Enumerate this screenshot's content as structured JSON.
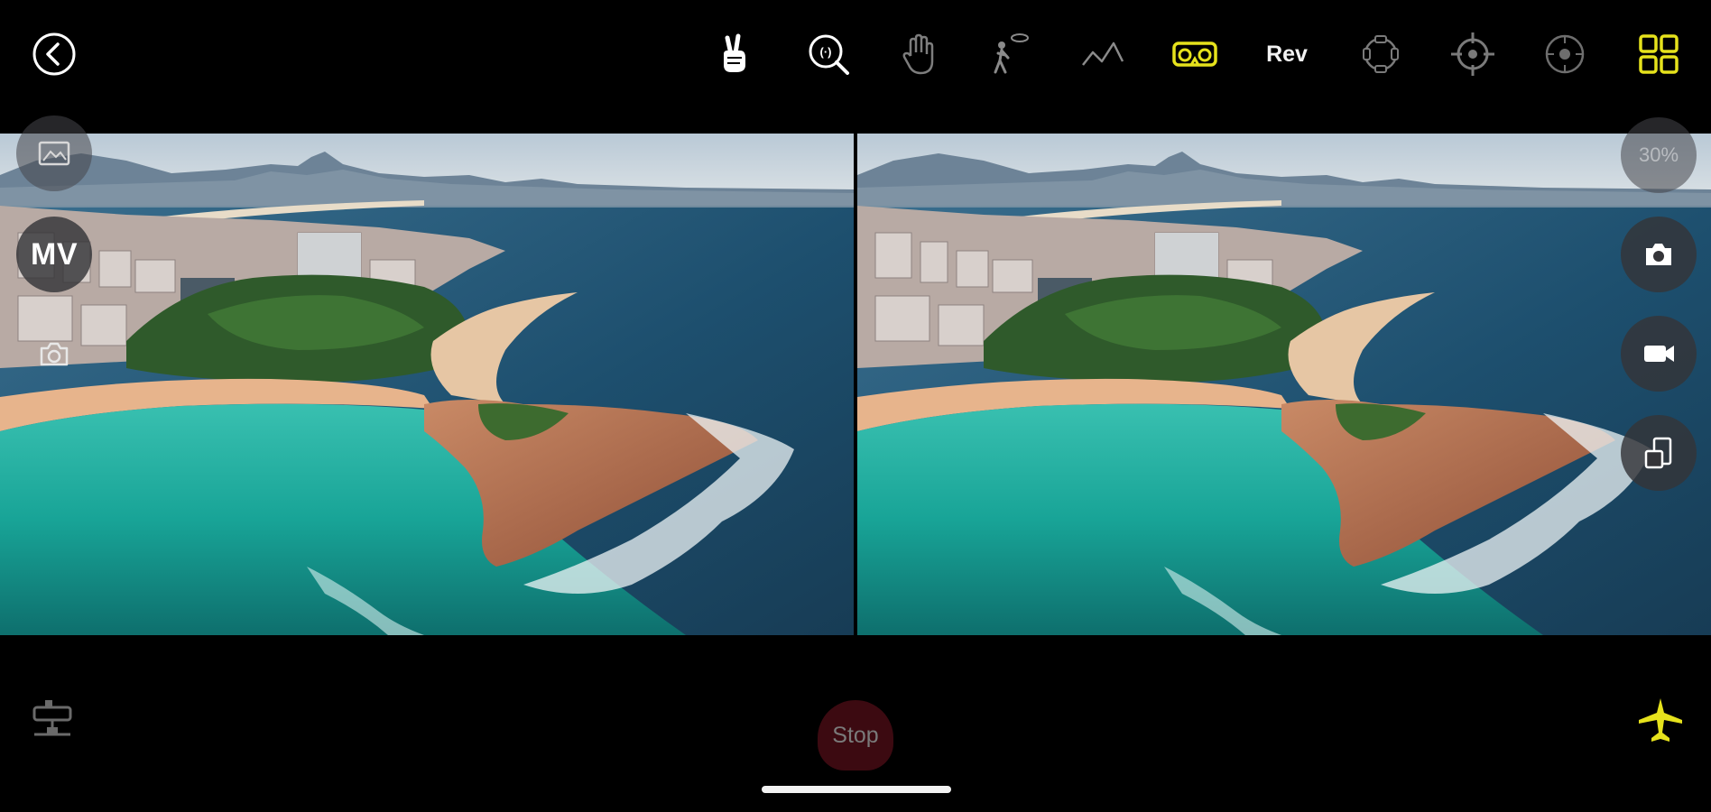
{
  "toolbar": {
    "icons": [
      "back-icon",
      "peace-gesture-icon",
      "zoom-magnifier-icon",
      "palm-gesture-icon",
      "follow-person-icon",
      "path-line-icon",
      "vr-goggles-icon",
      "rev-mode",
      "rotation-icon",
      "crosshair-target-icon",
      "circle-target-icon",
      "grid-layout-icon"
    ],
    "rev_label": "Rev",
    "accent_color": "#e6e21c"
  },
  "left_panel": {
    "mv_label": "MV",
    "icons": [
      "gallery-icon",
      "camera-icon"
    ]
  },
  "right_panel": {
    "zoom_label": "30%",
    "icons": [
      "photo-camera-icon",
      "video-camera-icon",
      "layout-swap-icon"
    ]
  },
  "bottom": {
    "stop_label": "Stop",
    "icons": [
      "network-device-icon",
      "drone-icon"
    ],
    "stop_color": "#3c0a11"
  },
  "scene": {
    "description_colors": {
      "sky": "#cdd8e0",
      "ocean": "#1d4f6e",
      "lagoon": "#19a89b",
      "sand": "#e7b48c",
      "rocks": "#b97552"
    }
  }
}
